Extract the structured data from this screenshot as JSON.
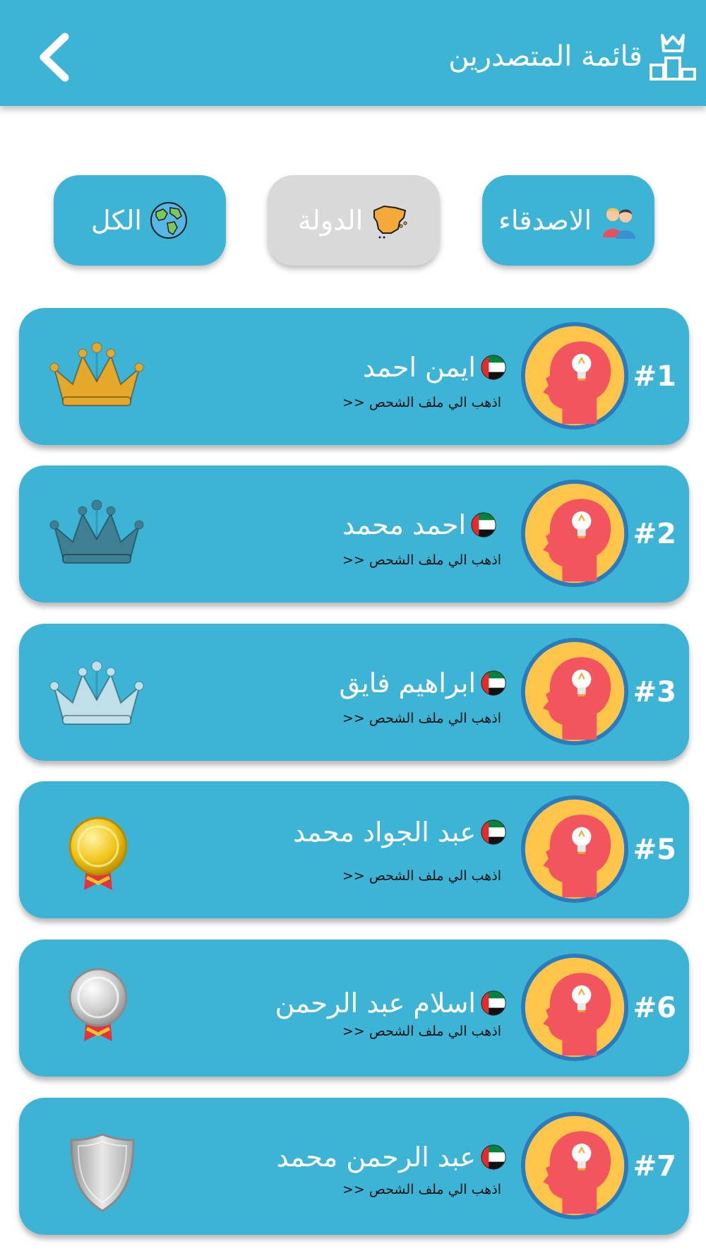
{
  "header": {
    "title": "قائمة المتصدرين",
    "podium_icon": "podium-crown-icon",
    "back_icon": "chevron-left-icon",
    "background": "#3db4d6"
  },
  "tabs": [
    {
      "id": "friends",
      "label": "الاصدقاء",
      "icon": "friends-icon",
      "active": true
    },
    {
      "id": "country",
      "label": "الدولة",
      "icon": "spain-map-icon",
      "active": false
    },
    {
      "id": "all",
      "label": "الكل",
      "icon": "globe-icon",
      "active": true
    }
  ],
  "players": [
    {
      "rank": "#1",
      "name": "ايمن احمد",
      "link": "اذهب الي ملف الشحص <<",
      "flag": "uae-flag-icon",
      "badge": "gold-crown-icon"
    },
    {
      "rank": "#2",
      "name": "احمد محمد",
      "link": "اذهب الي ملف الشحص <<",
      "flag": "uae-flag-icon",
      "badge": "teal-crown-icon"
    },
    {
      "rank": "#3",
      "name": "ابراهيم فايق",
      "link": "اذهب الي ملف الشحص <<",
      "flag": "uae-flag-icon",
      "badge": "silver-crown-icon"
    },
    {
      "rank": "#5",
      "name": "عبد الجواد محمد",
      "link": "اذهب الي ملف الشحص <<",
      "flag": "uae-flag-icon",
      "badge": "gold-medal-icon"
    },
    {
      "rank": "#6",
      "name": "اسلام عبد الرحمن",
      "link": "اذهب الي ملف الشحص <<",
      "flag": "uae-flag-icon",
      "badge": "silver-medal-icon"
    },
    {
      "rank": "#7",
      "name": "عبد الرحمن محمد",
      "link": "اذهب الي ملف الشحص <<",
      "flag": "uae-flag-icon",
      "badge": "silver-shield-icon"
    }
  ],
  "colors": {
    "primary": "#3db4d6",
    "inactive_tab": "#d9d9d9",
    "avatar_bg": "#fdc64a",
    "avatar_head": "#f2555e",
    "avatar_ring": "#2a7bbd"
  }
}
